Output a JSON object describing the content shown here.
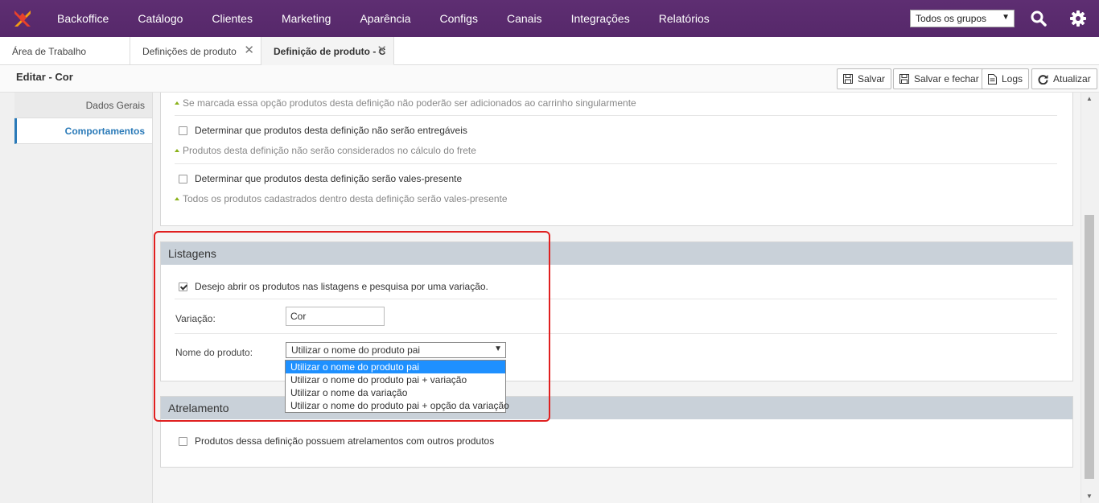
{
  "nav": {
    "items": [
      "Backoffice",
      "Catálogo",
      "Clientes",
      "Marketing",
      "Aparência",
      "Configs",
      "Canais",
      "Integrações",
      "Relatórios"
    ],
    "group_select": "Todos os grupos",
    "accent": "#5b2c6f",
    "logo_colors": [
      "#e8412c",
      "#f39c12"
    ]
  },
  "tabs": [
    {
      "label": "Área de Trabalho"
    },
    {
      "label": "Definições de produto",
      "close": "✕"
    },
    {
      "label": "Definição de produto - C",
      "close": "✕"
    }
  ],
  "header": {
    "title": "Editar - Cor",
    "buttons": {
      "save": "Salvar",
      "save_close": "Salvar e fechar",
      "logs": "Logs",
      "refresh": "Atualizar"
    }
  },
  "sidebar": {
    "items": [
      {
        "label": "Dados Gerais"
      },
      {
        "label": "Comportamentos"
      }
    ]
  },
  "behaviors": {
    "hint_cart": "Se marcada essa opção produtos desta definição não poderão ser adicionados ao carrinho singularmente",
    "not_deliverable": "Determinar que produtos desta definição não serão entregáveis",
    "hint_freight": "Produtos desta definição não serão considerados no cálculo do frete",
    "gift_card": "Determinar que produtos desta definição serão vales-presente",
    "hint_gift": "Todos os produtos cadastrados dentro desta definição serão vales-presente"
  },
  "listagens": {
    "title": "Listagens",
    "open_by_variation": "Desejo abrir os produtos nas listagens e pesquisa por uma variação.",
    "variation_label": "Variação:",
    "variation_value": "Cor",
    "product_name_label": "Nome do produto:",
    "product_name_selected": "Utilizar o nome do produto pai",
    "options": [
      "Utilizar o nome do produto pai",
      "Utilizar o nome do produto pai + variação",
      "Utilizar o nome da variação",
      "Utilizar o nome do produto pai + opção da variação"
    ]
  },
  "atrelamento": {
    "title": "Atrelamento",
    "linked": "Produtos dessa definição possuem atrelamentos com outros produtos"
  }
}
